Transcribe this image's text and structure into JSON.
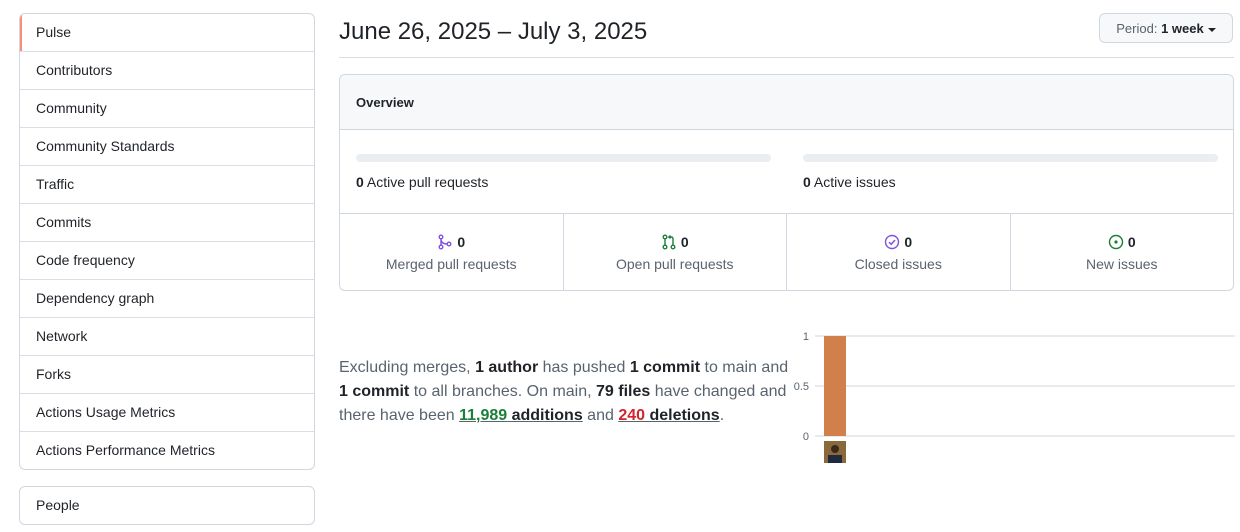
{
  "sidebar": {
    "items": [
      {
        "label": "Pulse",
        "selected": true
      },
      {
        "label": "Contributors"
      },
      {
        "label": "Community"
      },
      {
        "label": "Community Standards"
      },
      {
        "label": "Traffic"
      },
      {
        "label": "Commits"
      },
      {
        "label": "Code frequency"
      },
      {
        "label": "Dependency graph"
      },
      {
        "label": "Network"
      },
      {
        "label": "Forks"
      },
      {
        "label": "Actions Usage Metrics"
      },
      {
        "label": "Actions Performance Metrics"
      }
    ],
    "people_label": "People"
  },
  "header": {
    "date_range": "June 26, 2025 – July 3, 2025",
    "period_label": "Period:",
    "period_value": "1 week"
  },
  "overview": {
    "title": "Overview",
    "active_prs_count": "0",
    "active_prs_label": "Active pull requests",
    "active_issues_count": "0",
    "active_issues_label": "Active issues",
    "stats": [
      {
        "icon": "merged-pr-icon",
        "count": "0",
        "label": "Merged pull requests",
        "color": "#8250df"
      },
      {
        "icon": "open-pr-icon",
        "count": "0",
        "label": "Open pull requests",
        "color": "#1a7f37"
      },
      {
        "icon": "closed-issue-icon",
        "count": "0",
        "label": "Closed issues",
        "color": "#8250df"
      },
      {
        "icon": "new-issue-icon",
        "count": "0",
        "label": "New issues",
        "color": "#1a7f37"
      }
    ]
  },
  "summary": {
    "t1": "Excluding merges, ",
    "authors": "1 author",
    "t2": " has pushed ",
    "commits_main": "1 commit",
    "t3": " to main and ",
    "commits_all": "1 commit",
    "t4": " to all branches. On main, ",
    "files": "79 files",
    "t5": " have changed and there have been ",
    "additions_num": "11,989",
    "additions_word": " additions",
    "t6": " and ",
    "deletions_num": "240",
    "deletions_word": " deletions",
    "t7": "."
  },
  "chart_data": {
    "type": "bar",
    "categories": [
      "author-1"
    ],
    "values": [
      1
    ],
    "y_ticks": [
      "0",
      "0.5",
      "1"
    ],
    "ylim": [
      0,
      1
    ],
    "bar_color": "#d2804b"
  }
}
